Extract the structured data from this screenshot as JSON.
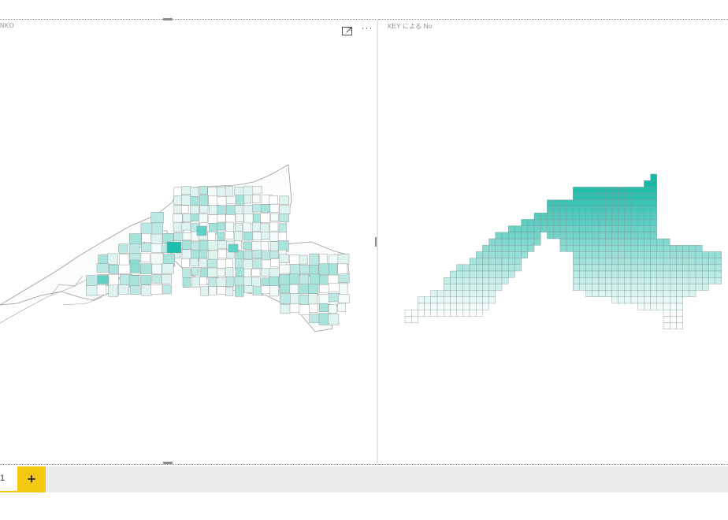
{
  "visuals": {
    "left": {
      "title": "NKO"
    },
    "right": {
      "title": "KEY による No"
    }
  },
  "header_icons": [
    "focus-mode-icon",
    "more-options-icon"
  ],
  "more_options_glyph": "···",
  "colors": {
    "accent": "#f2c811",
    "map_base": "#ffffff",
    "map_light": "#dff4f1",
    "map_mid": "#bce9e3",
    "map_strong": "#5fd2c6",
    "map_max": "#1dbfad",
    "grid_top": "#19b8a6",
    "grid_bottom": "#ffffff",
    "stroke": "#9a9a9a"
  },
  "page_tabs": {
    "tabs": [
      {
        "label": "1"
      }
    ],
    "add_label": "+"
  }
}
